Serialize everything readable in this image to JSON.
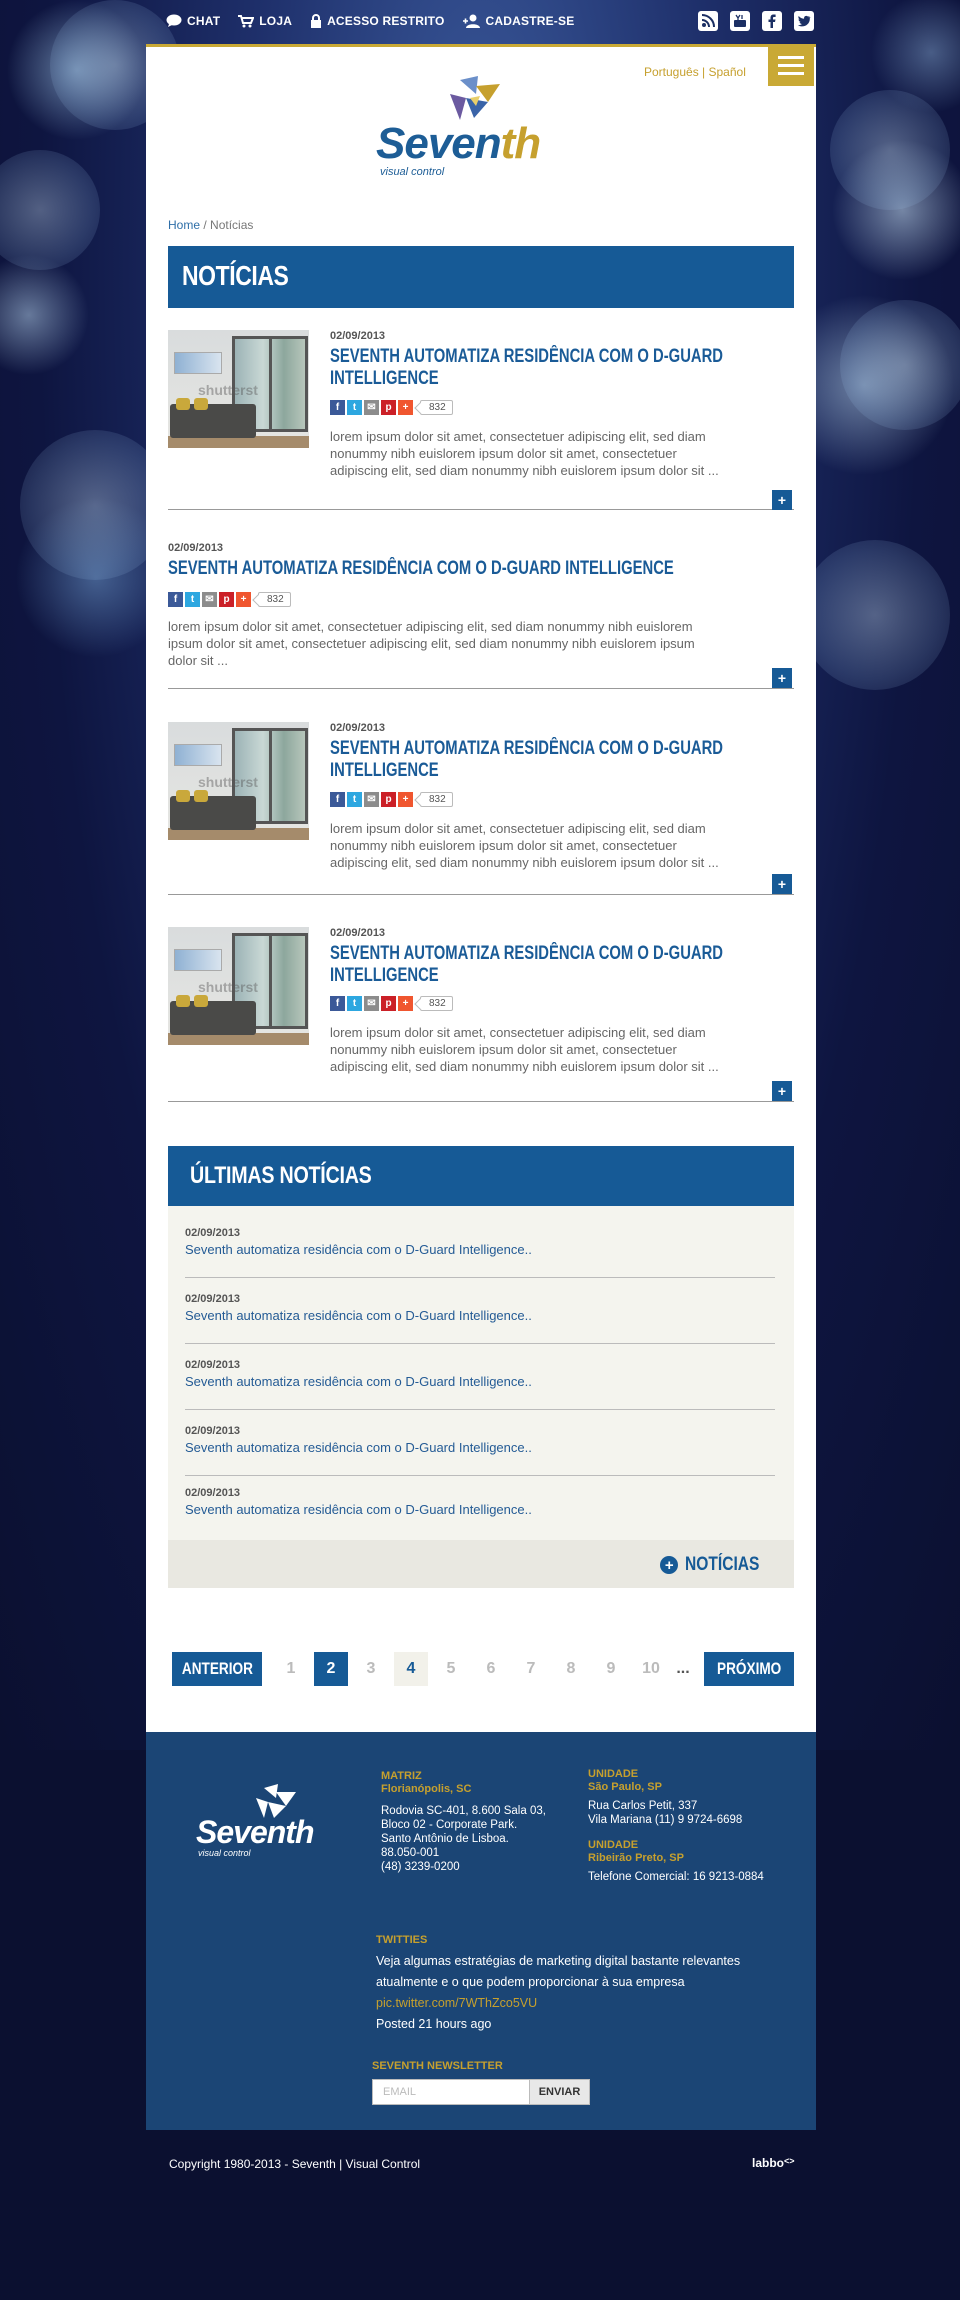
{
  "topbar": {
    "chat_label": "CHAT",
    "loja_label": "LOJA",
    "acesso_label": "ACESSO RESTRITO",
    "cadastre_label": "CADASTRE-SE",
    "social_icons": [
      "rss-icon",
      "youtube-icon",
      "facebook-icon",
      "twitter-icon"
    ]
  },
  "header": {
    "lang_pt": "Português",
    "lang_sep": " | ",
    "lang_es": "Spañol",
    "logo_word_1": "Seven",
    "logo_word_2": "th",
    "logo_tagline": "visual control"
  },
  "breadcrumb": {
    "home": "Home",
    "sep": " / ",
    "current": "Notícias"
  },
  "page_title": "NOTÍCIAS",
  "news": [
    {
      "date": "02/09/2013",
      "title_line1": "SEVENTH AUTOMATIZA RESIDÊNCIA COM O D-GUARD",
      "title_line2": "INTELLIGENCE",
      "share_count": "832",
      "text_line1": "lorem ipsum dolor sit amet, consectetuer adipiscing elit, sed diam",
      "text_line2": "nonummy nibh euislorem ipsum dolor sit amet, consectetuer",
      "text_line3": "adipiscing elit, sed diam nonummy nibh euislorem ipsum dolor sit ...",
      "has_image": true,
      "image_watermark": "shutterst"
    },
    {
      "date": "02/09/2013",
      "title_line1": "SEVENTH AUTOMATIZA RESIDÊNCIA COM O D-GUARD INTELLIGENCE",
      "share_count": "832",
      "text_line1": "lorem ipsum dolor sit amet, consectetuer adipiscing elit, sed diam nonummy nibh euislorem",
      "text_line2": "ipsum dolor sit amet, consectetuer adipiscing elit, sed diam nonummy nibh euislorem ipsum",
      "text_line3": "dolor sit ...",
      "has_image": false
    },
    {
      "date": "02/09/2013",
      "title_line1": "SEVENTH AUTOMATIZA RESIDÊNCIA COM O D-GUARD",
      "title_line2": "INTELLIGENCE",
      "share_count": "832",
      "text_line1": "lorem ipsum dolor sit amet, consectetuer adipiscing elit, sed diam",
      "text_line2": "nonummy nibh euislorem ipsum dolor sit amet, consectetuer",
      "text_line3": "adipiscing elit, sed diam nonummy nibh euislorem ipsum dolor sit ...",
      "has_image": true,
      "image_watermark": "shutterst"
    },
    {
      "date": "02/09/2013",
      "title_line1": "SEVENTH AUTOMATIZA RESIDÊNCIA COM O D-GUARD",
      "title_line2": "INTELLIGENCE",
      "share_count": "832",
      "text_line1": "lorem ipsum dolor sit amet, consectetuer adipiscing elit, sed diam",
      "text_line2": "nonummy nibh euislorem ipsum dolor sit amet, consectetuer",
      "text_line3": "adipiscing elit, sed diam nonummy nibh euislorem ipsum dolor sit ...",
      "has_image": true,
      "image_watermark": "shutterst"
    }
  ],
  "more_symbol": "+",
  "share_buttons": [
    {
      "icon": "facebook-icon",
      "glyph": "f",
      "color": "#3b5998"
    },
    {
      "icon": "twitter-icon",
      "glyph": "t",
      "color": "#2da7e0"
    },
    {
      "icon": "email-icon",
      "glyph": "✉",
      "color": "#8c8c8c"
    },
    {
      "icon": "pinterest-icon",
      "glyph": "p",
      "color": "#cb2027"
    },
    {
      "icon": "more-icon",
      "glyph": "+",
      "color": "#f0562f"
    }
  ],
  "ultimas": {
    "title": "ÚLTIMAS NOTÍCIAS",
    "items": [
      {
        "date": "02/09/2013",
        "title": "Seventh automatiza residência com o D-Guard Intelligence.."
      },
      {
        "date": "02/09/2013",
        "title": "Seventh automatiza residência com o D-Guard Intelligence.."
      },
      {
        "date": "02/09/2013",
        "title": "Seventh automatiza residência com o D-Guard Intelligence.."
      },
      {
        "date": "02/09/2013",
        "title": "Seventh automatiza residência com o D-Guard Intelligence.."
      },
      {
        "date": "02/09/2013",
        "title": "Seventh automatiza residência com o D-Guard Intelligence.."
      }
    ],
    "more_label": "NOTÍCIAS",
    "more_symbol": "+"
  },
  "pagination": {
    "prev_label": "ANTERIOR",
    "next_label": "PRÓXIMO",
    "pages": [
      "1",
      "2",
      "3",
      "4",
      "5",
      "6",
      "7",
      "8",
      "9",
      "10"
    ],
    "ellipsis": "...",
    "current_page": "2"
  },
  "footer": {
    "logo_word": "Seventh",
    "logo_tagline": "visual control",
    "matriz_heading": "MATRIZ",
    "matriz_city": "Florianópolis, SC",
    "matriz_address": [
      "Rodovia SC-401, 8.600 Sala 03,",
      "Bloco 02 - Corporate Park.",
      "Santo Antônio de Lisboa.",
      "88.050-001",
      "(48) 3239-0200"
    ],
    "unidade1_heading": "UNIDADE",
    "unidade1_city": "São Paulo, SP",
    "unidade1_address": [
      "Rua Carlos Petit, 337",
      "Vila Mariana (11) 9 9724-6698"
    ],
    "unidade2_heading": "UNIDADE",
    "unidade2_city": "Ribeirão Preto, SP",
    "unidade2_phone": "Telefone Comercial: 16 9213-0884",
    "twitties_heading": "TWITTIES",
    "tweet_line1": "Veja algumas estratégias de marketing digital bastante relevantes",
    "tweet_line2": "atualmente e o que podem proporcionar à sua empresa",
    "tweet_link": "pic.twitter.com/7WThZco5VU",
    "tweet_posted": "Posted 21 hours ago",
    "newsletter_heading": "SEVENTH NEWSLETTER",
    "newsletter_placeholder": "EMAIL",
    "newsletter_button": "ENVIAR"
  },
  "bottom": {
    "copyright": "Copyright 1980-2013 - Seventh | Visual Control",
    "agency": "labbo"
  },
  "colors": {
    "primary_blue": "#165a96",
    "gold": "#c9a935",
    "footer_blue": "#1b4575"
  }
}
